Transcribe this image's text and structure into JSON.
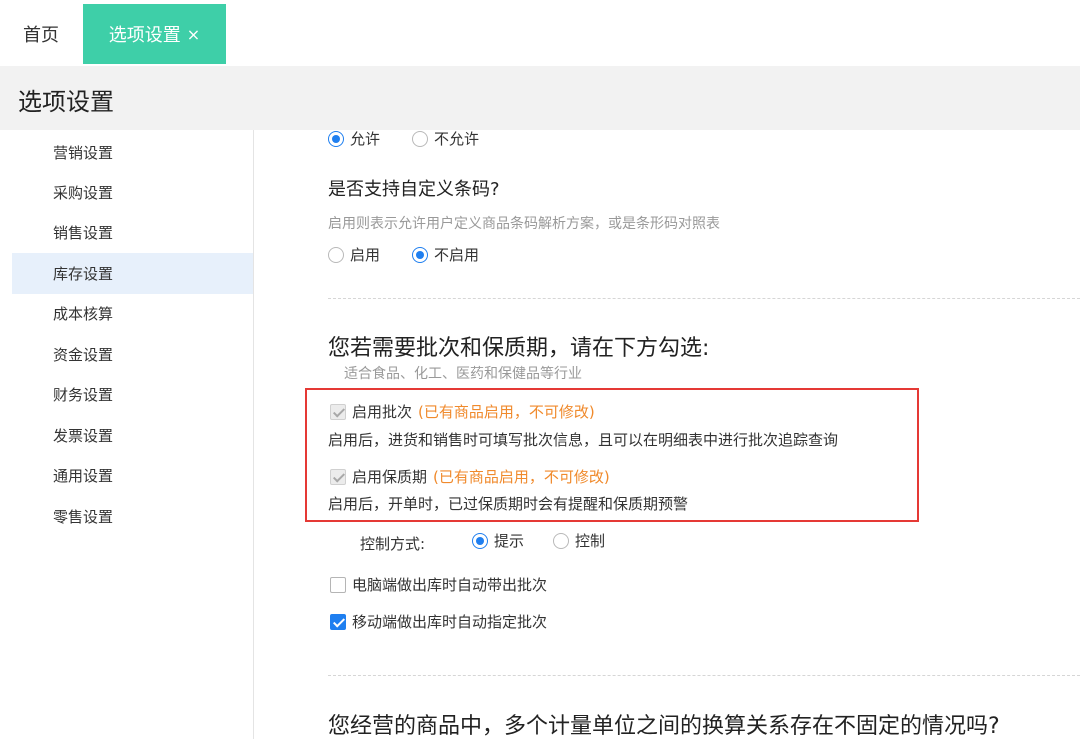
{
  "tabs": {
    "home_label": "首页",
    "active_label": "选项设置",
    "close_glyph": "×"
  },
  "page_title": "选项设置",
  "sidebar": {
    "items": [
      {
        "label": "营销设置"
      },
      {
        "label": "采购设置"
      },
      {
        "label": "销售设置"
      },
      {
        "label": "库存设置",
        "active": true
      },
      {
        "label": "成本核算"
      },
      {
        "label": "资金设置"
      },
      {
        "label": "财务设置"
      },
      {
        "label": "发票设置"
      },
      {
        "label": "通用设置"
      },
      {
        "label": "零售设置"
      }
    ]
  },
  "content": {
    "top_radio": {
      "opt1": "允许",
      "opt2": "不允许",
      "selected": "opt1"
    },
    "barcode": {
      "question": "是否支持自定义条码?",
      "hint": "启用则表示允许用户定义商品条码解析方案，或是条形码对照表",
      "opt1": "启用",
      "opt2": "不启用",
      "selected": "opt2"
    },
    "batch": {
      "heading": "您若需要批次和保质期，请在下方勾选:",
      "subheading": "适合食品、化工、医药和保健品等行业",
      "enable_batch_label": "启用批次",
      "enable_batch_warn": "(已有商品启用，不可修改)",
      "enable_batch_desc": "启用后，进货和销售时可填写批次信息，且可以在明细表中进行批次追踪查询",
      "enable_shelf_label": "启用保质期",
      "enable_shelf_warn": "(已有商品启用，不可修改)",
      "enable_shelf_desc": "启用后，开单时，已过保质期时会有提醒和保质期预警",
      "control_label": "控制方式:",
      "control_opt1": "提示",
      "control_opt2": "控制",
      "control_selected": "opt1",
      "pc_auto_label": "电脑端做出库时自动带出批次",
      "pc_auto_checked": false,
      "mobile_auto_label": "移动端做出库时自动指定批次",
      "mobile_auto_checked": true
    },
    "unit_question": "您经营的商品中，多个计量单位之间的换算关系存在不固定的情况吗?"
  },
  "colors": {
    "accent": "#3ecfa8",
    "primary": "#1f7ff0",
    "warning": "#f08a2c",
    "highlight_border": "#e53935",
    "sidebar_active_bg": "#e7f0fb"
  }
}
